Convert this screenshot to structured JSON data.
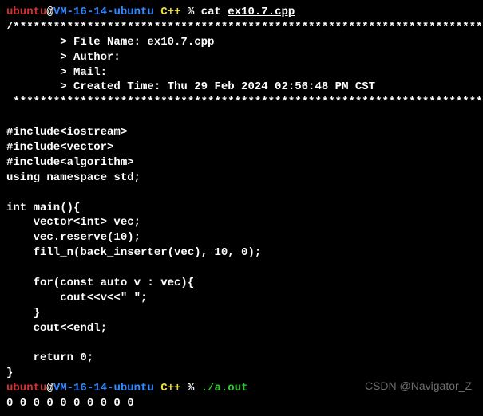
{
  "prompt1": {
    "user": "ubuntu",
    "at": "@",
    "host": "VM-16-14-ubuntu",
    "dir": " C++",
    "pct": " % ",
    "cmd": "cat ",
    "arg": "ex10.7.cpp"
  },
  "comment_top": "/*************************************************************************",
  "file_name_line": "        > File Name: ex10.7.cpp",
  "author_line": "        > Author:",
  "mail_line": "        > Mail:",
  "created_line": "        > Created Time: Thu 29 Feb 2024 02:56:48 PM CST",
  "comment_bot": " ************************************************************************/",
  "blank": "",
  "inc1": "#include<iostream>",
  "inc2": "#include<vector>",
  "inc3": "#include<algorithm>",
  "using": "using namespace std;",
  "main_sig": "int main(){",
  "l_vec": "    vector<int> vec;",
  "l_res": "    vec.reserve(10);",
  "l_fill": "    fill_n(back_inserter(vec), 10, 0);",
  "l_for": "    for(const auto v : vec){",
  "l_cout": "        cout<<v<<\" \";",
  "l_brace": "    }",
  "l_endl": "    cout<<endl;",
  "l_ret": "    return 0;",
  "l_close": "}",
  "prompt2": {
    "user": "ubuntu",
    "at": "@",
    "host": "VM-16-14-ubuntu",
    "dir": " C++",
    "pct": " % ",
    "cmd": "./a.out"
  },
  "output": "0 0 0 0 0 0 0 0 0 0",
  "watermark": "CSDN @Navigator_Z"
}
